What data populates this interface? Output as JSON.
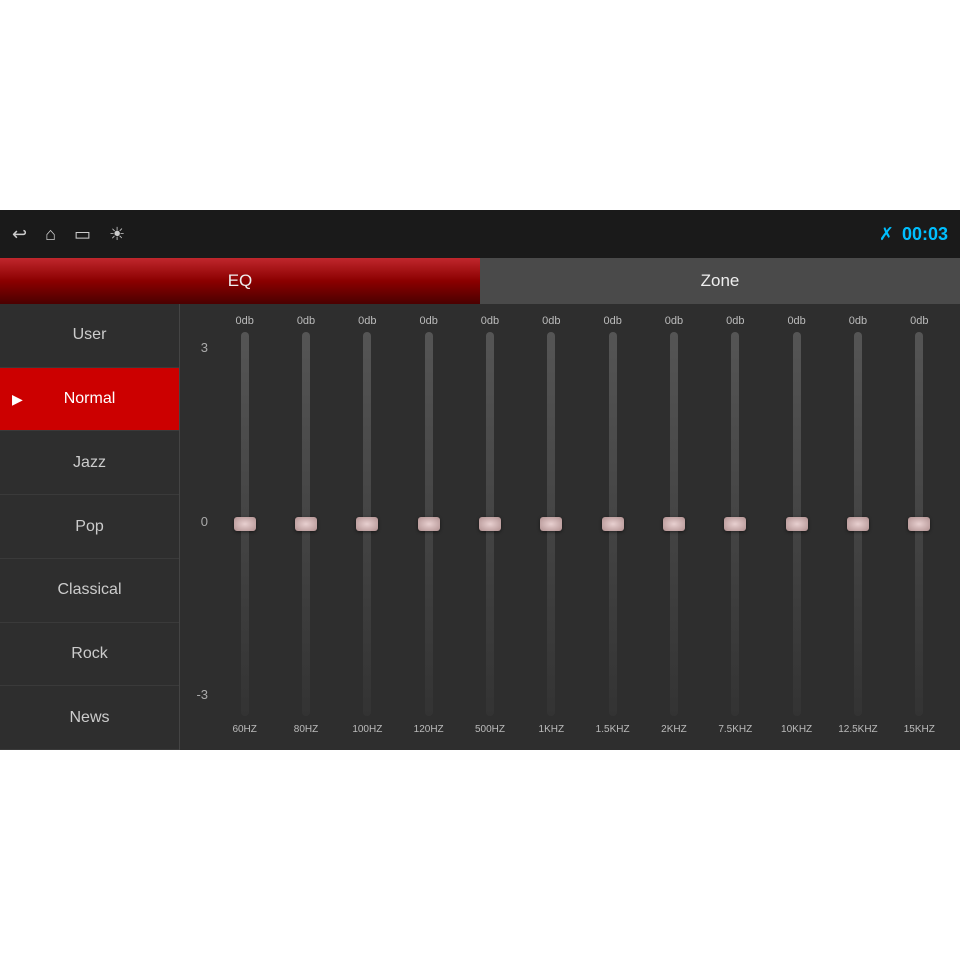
{
  "topbar": {
    "time": "00:03",
    "bluetooth_label": "BT"
  },
  "tabs": [
    {
      "id": "eq",
      "label": "EQ",
      "active": true
    },
    {
      "id": "zone",
      "label": "Zone",
      "active": false
    }
  ],
  "sidebar": {
    "items": [
      {
        "id": "user",
        "label": "User",
        "active": false,
        "playing": false
      },
      {
        "id": "normal",
        "label": "Normal",
        "active": true,
        "playing": true
      },
      {
        "id": "jazz",
        "label": "Jazz",
        "active": false,
        "playing": false
      },
      {
        "id": "pop",
        "label": "Pop",
        "active": false,
        "playing": false
      },
      {
        "id": "classical",
        "label": "Classical",
        "active": false,
        "playing": false
      },
      {
        "id": "rock",
        "label": "Rock",
        "active": false,
        "playing": false
      },
      {
        "id": "news",
        "label": "News",
        "active": false,
        "playing": false
      }
    ]
  },
  "eq": {
    "scale_top": "3",
    "scale_mid": "0",
    "scale_bot": "-3",
    "bands": [
      {
        "freq": "60HZ",
        "db": "0db",
        "value": 0
      },
      {
        "freq": "80HZ",
        "db": "0db",
        "value": 0
      },
      {
        "freq": "100HZ",
        "db": "0db",
        "value": 0
      },
      {
        "freq": "120HZ",
        "db": "0db",
        "value": 0
      },
      {
        "freq": "500HZ",
        "db": "0db",
        "value": 0
      },
      {
        "freq": "1KHZ",
        "db": "0db",
        "value": 0
      },
      {
        "freq": "1.5KHZ",
        "db": "0db",
        "value": 0
      },
      {
        "freq": "2KHZ",
        "db": "0db",
        "value": 0
      },
      {
        "freq": "7.5KHZ",
        "db": "0db",
        "value": 0
      },
      {
        "freq": "10KHZ",
        "db": "0db",
        "value": 0
      },
      {
        "freq": "12.5KHZ",
        "db": "0db",
        "value": 0
      },
      {
        "freq": "15KHZ",
        "db": "0db",
        "value": 0
      }
    ]
  }
}
